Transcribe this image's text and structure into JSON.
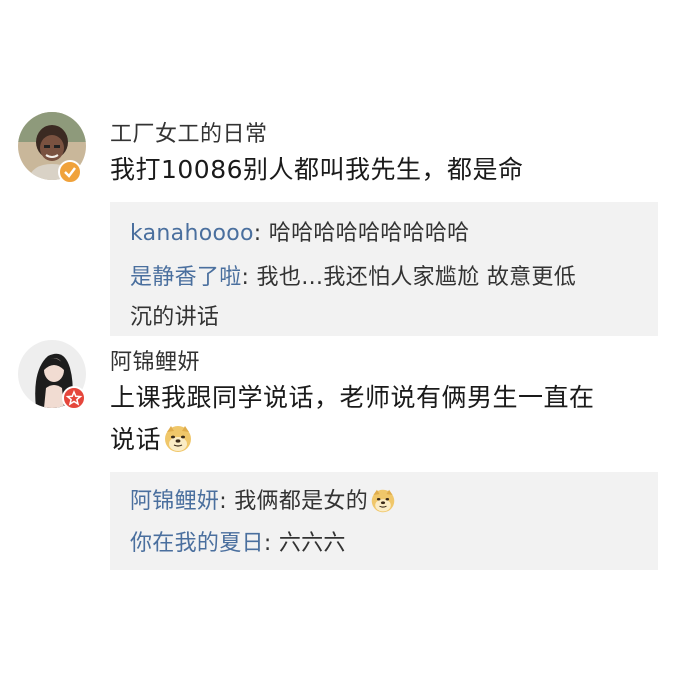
{
  "comments": [
    {
      "username": "工厂女工的日常",
      "text": "我打10086别人都叫我先生，都是命",
      "avatar_icon": "user-avatar-photo-icon",
      "badge_icon": "verified-badge-icon",
      "replies": [
        {
          "name": "kanahoooo",
          "text": "哈哈哈哈哈哈哈哈哈"
        },
        {
          "name": "是静香了啦",
          "text": "我也…我还怕人家尴尬 故意更低",
          "text_cont": "沉的讲话"
        }
      ]
    },
    {
      "username": "阿锦鲤妍",
      "text_line1": "上课我跟同学说话，老师说有俩男生一直在",
      "text_line2": "说话",
      "emoji_icon": "doge-emoji-icon",
      "avatar_icon": "user-avatar-photo-icon",
      "badge_icon": "vip-star-badge-icon",
      "replies": [
        {
          "name": "阿锦鲤妍",
          "text": "我俩都是女的",
          "emoji_icon": "doge-emoji-icon"
        },
        {
          "name": "你在我的夏日",
          "text": "六六六"
        }
      ]
    }
  ],
  "colors": {
    "reply_name": "#4a6f9e",
    "reply_bg": "#f2f2f2",
    "comment_text": "#1a1a1a",
    "username_text": "#333333"
  }
}
